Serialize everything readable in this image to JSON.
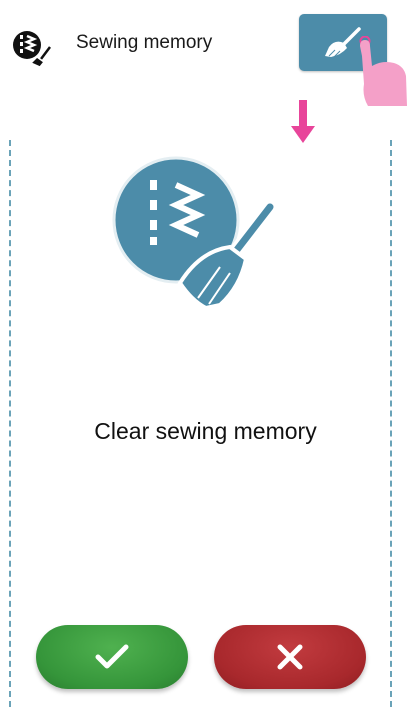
{
  "header": {
    "title": "Sewing memory",
    "icon": "sewing-memory-icon",
    "action_icon": "broom-icon"
  },
  "main": {
    "message": "Clear sewing memory",
    "illustration_icon": "clear-sewing-memory-icon"
  },
  "actions": {
    "confirm_icon": "checkmark-icon",
    "cancel_icon": "close-icon"
  },
  "colors": {
    "accent": "#4c8ca9",
    "confirm": "#3a9a3e",
    "cancel": "#ab2a2e",
    "pointer": "#e8459a",
    "hand": "#f4a0c8",
    "guide": "#6aa3b8"
  }
}
